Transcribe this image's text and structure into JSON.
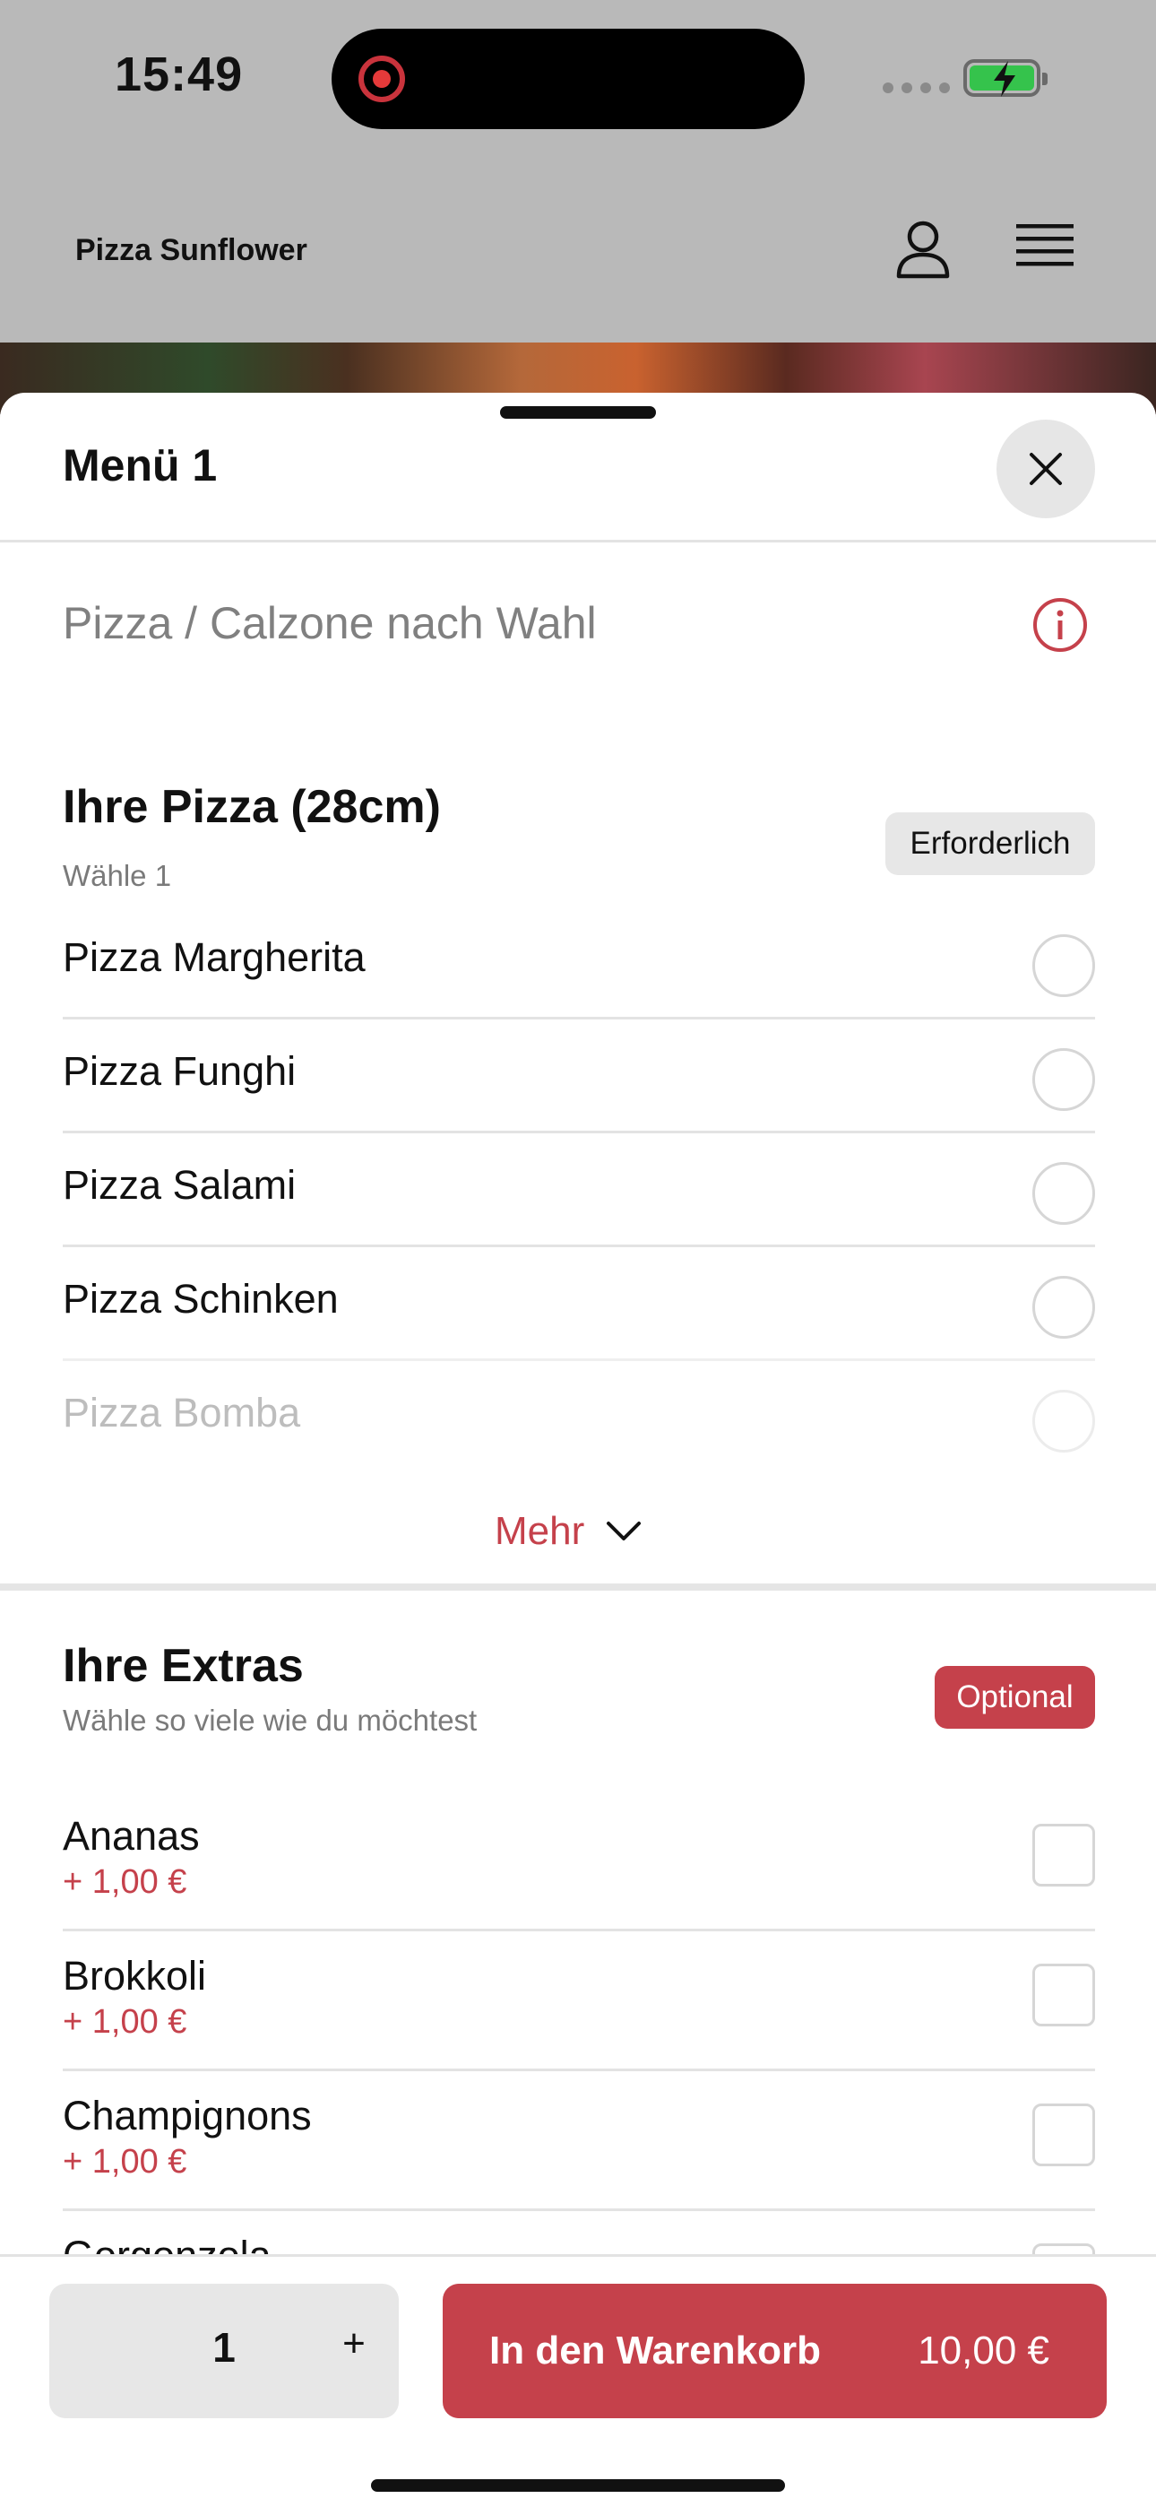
{
  "status_bar": {
    "time": "15:49"
  },
  "header": {
    "brand": "Pizza Sunflower"
  },
  "sheet": {
    "title": "Menü 1",
    "description": "Pizza / Calzone nach Wahl"
  },
  "pizza_section": {
    "title": "Ihre Pizza (28cm)",
    "subtitle": "Wähle 1",
    "badge": "Erforderlich",
    "options": [
      {
        "label": "Pizza Margherita"
      },
      {
        "label": "Pizza Funghi"
      },
      {
        "label": "Pizza Salami"
      },
      {
        "label": "Pizza Schinken"
      },
      {
        "label": "Pizza Bomba"
      }
    ],
    "more_label": "Mehr"
  },
  "extras_section": {
    "title": "Ihre Extras",
    "subtitle": "Wähle so viele wie du möchtest",
    "badge": "Optional",
    "items": [
      {
        "label": "Ananas",
        "price": "+ 1,00 €"
      },
      {
        "label": "Brokkoli",
        "price": "+ 1,00 €"
      },
      {
        "label": "Champignons",
        "price": "+ 1,00 €"
      },
      {
        "label": "Gorgonzola",
        "price": ""
      }
    ]
  },
  "footer": {
    "quantity": "1",
    "plus": "+",
    "cart_label": "In den Warenkorb",
    "cart_price": "10,00 €"
  },
  "colors": {
    "accent": "#c5414b",
    "backdrop": "#b9b9b9"
  }
}
